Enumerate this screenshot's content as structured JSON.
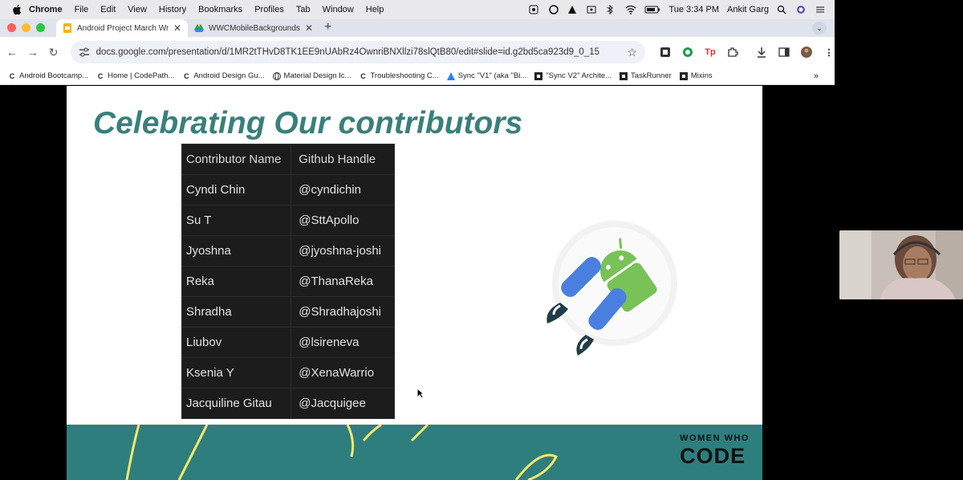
{
  "menubar": {
    "app": "Chrome",
    "menus": [
      "File",
      "Edit",
      "View",
      "History",
      "Bookmarks",
      "Profiles",
      "Tab",
      "Window",
      "Help"
    ],
    "clock": "Tue 3:34 PM",
    "user": "Ankit Garg"
  },
  "tabs": [
    {
      "label": "Android Project March Wrap",
      "icon": "google-slides-icon",
      "active": true
    },
    {
      "label": "WWCMobileBackgrounds - G",
      "icon": "google-drive-icon",
      "active": false
    }
  ],
  "toolbar": {
    "url": "docs.google.com/presentation/d/1MR2tTHvD8TK1EE9nUAbRz4OwnriBNXllzi78slQtB80/edit#slide=id.g2bd5ca923d9_0_15"
  },
  "bookmarks": [
    {
      "label": "Android Bootcamp...",
      "icon": "codepath-icon"
    },
    {
      "label": "Home | CodePath...",
      "icon": "codepath-icon"
    },
    {
      "label": "Android Design Gu...",
      "icon": "codepath-icon"
    },
    {
      "label": "Material Design Ic...",
      "icon": "globe-icon"
    },
    {
      "label": "Troubleshooting C...",
      "icon": "codepath-icon"
    },
    {
      "label": "Sync \"V1\" (aka \"Bi...",
      "icon": "atlassian-icon"
    },
    {
      "label": "\"Sync V2\" Archite...",
      "icon": "notion-icon"
    },
    {
      "label": "TaskRunner",
      "icon": "notion-icon"
    },
    {
      "label": "Mixins",
      "icon": "notion-icon"
    }
  ],
  "slide": {
    "title": "Celebrating Our contributors",
    "table": {
      "headers": [
        "Contributor Name",
        "Github Handle"
      ],
      "rows": [
        [
          "Cyndi Chin",
          "@cyndichin"
        ],
        [
          "Su T",
          "@SttApollo"
        ],
        [
          "Jyoshna",
          "@jyoshna-joshi"
        ],
        [
          "Reka",
          "@ThanaReka"
        ],
        [
          "Shradha",
          "@Shradhajoshi"
        ],
        [
          "Liubov",
          "@lsireneva"
        ],
        [
          "Ksenia Y",
          "@XenaWarrio"
        ],
        [
          "Jacquiline Gitau",
          "@Jacquigee"
        ]
      ]
    },
    "footer": {
      "brand_line1": "WOMEN WHO",
      "brand_line2": "CODE"
    }
  },
  "colors": {
    "title": "#3a7f7b",
    "footer_band": "#2e7e7e",
    "table_bg": "#1c1c1c",
    "android_green": "#78c257",
    "android_blue": "#4285f4"
  }
}
